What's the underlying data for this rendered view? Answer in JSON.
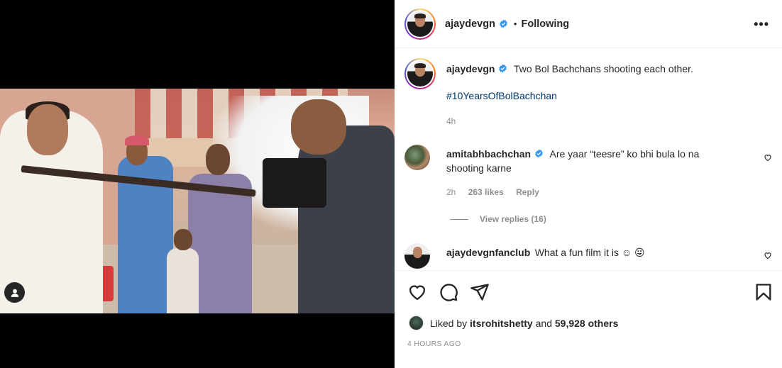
{
  "header": {
    "username": "ajaydevgn",
    "separator": "•",
    "follow_state": "Following",
    "more_label": "•••"
  },
  "caption": {
    "username": "ajaydevgn",
    "text": "Two Bol Bachchans shooting each other.",
    "hashtag": "#10YearsOfBolBachchan",
    "time": "4h"
  },
  "comments": [
    {
      "username": "amitabhbachchan",
      "text": "Are yaar “teesre” ko bhi bula lo na shooting karne",
      "time": "2h",
      "likes": "263 likes",
      "reply_label": "Reply",
      "view_replies": "View replies (16)"
    },
    {
      "username": "ajaydevgnfanclub",
      "text": "What a fun film it is ☺ 😜"
    }
  ],
  "likes": {
    "prefix": "Liked by",
    "user": "itsrohitshetty",
    "and": "and",
    "others": "59,928 others"
  },
  "timestamp": "4 HOURS AGO",
  "icons": {
    "like": "heart-icon",
    "comment": "comment-icon",
    "share": "send-icon",
    "save": "bookmark-icon",
    "more": "more-options-icon",
    "verified": "verified-badge-icon",
    "tagged": "user-tag-icon"
  },
  "colors": {
    "verified": "#3897f0",
    "hashtag": "#00376b",
    "muted": "#8e8e8e",
    "text": "#262626"
  }
}
